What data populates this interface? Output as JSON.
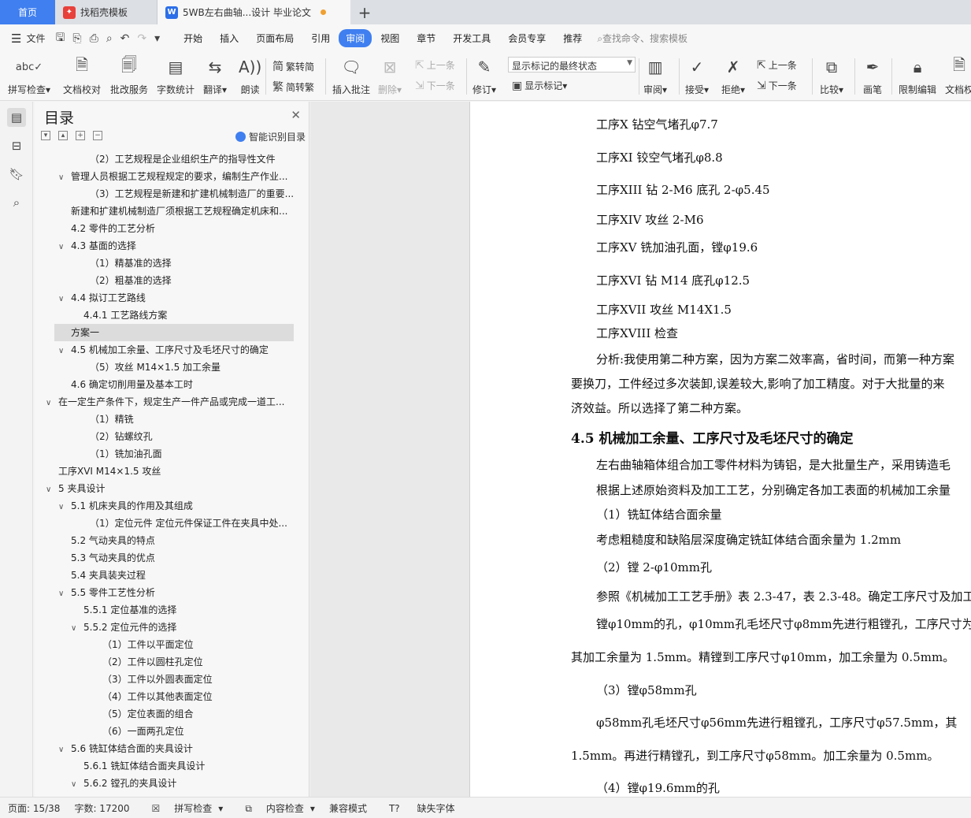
{
  "tabs": {
    "home": "首页",
    "template": "找稻壳模板",
    "doc": "5WB左右曲轴...设计 毕业论文"
  },
  "menu": {
    "file": "文件",
    "items": [
      "开始",
      "插入",
      "页面布局",
      "引用",
      "审阅",
      "视图",
      "章节",
      "开发工具",
      "会员专享",
      "推荐"
    ],
    "search": "查找命令、搜索模板"
  },
  "ribbon": {
    "spell": "拼写检查",
    "proof": "文档校对",
    "batch": "批改服务",
    "wordcount": "字数统计",
    "translate": "翻译",
    "read": "朗读",
    "trad": "繁转简",
    "simp": "简转繁",
    "insert_comment": "插入批注",
    "delete": "删除",
    "prev": "上一条",
    "next": "下一条",
    "revise": "修订",
    "display_combo": "显示标记的最终状态",
    "show_marks": "显示标记",
    "review": "审阅",
    "accept": "接受",
    "reject": "拒绝",
    "prev2": "上一条",
    "next2": "下一条",
    "compare": "比较",
    "pen": "画笔",
    "restrict": "限制编辑",
    "docpriv": "文档权"
  },
  "nav": {
    "title": "目录",
    "smart": "智能识别目录",
    "items": [
      {
        "text": "（2）工艺规程是企业组织生产的指导性文件",
        "level": 3,
        "chev": false
      },
      {
        "text": "管理人员根据工艺规程规定的要求，编制生产作业...",
        "level": 1,
        "chev": true
      },
      {
        "text": "（3）工艺规程是新建和扩建机械制造厂的重要...",
        "level": 3,
        "chev": false
      },
      {
        "text": "新建和扩建机械制造厂须根据工艺规程确定机床和...",
        "level": 1,
        "chev": false
      },
      {
        "text": "4.2   零件的工艺分析",
        "level": 1,
        "chev": false
      },
      {
        "text": "4.3   基面的选择",
        "level": 1,
        "chev": true
      },
      {
        "text": "（1）精基准的选择",
        "level": 3,
        "chev": false
      },
      {
        "text": "（2）粗基准的选择",
        "level": 3,
        "chev": false
      },
      {
        "text": "4.4   拟订工艺路线",
        "level": 1,
        "chev": true
      },
      {
        "text": "4.4.1   工艺路线方案",
        "level": 2,
        "chev": false
      },
      {
        "text": "方案一",
        "level": 1,
        "chev": false
      },
      {
        "text": "4.5   机械加工余量、工序尺寸及毛坯尺寸的确定",
        "level": 1,
        "chev": true
      },
      {
        "text": "（5）攻丝 M14×1.5 加工余量",
        "level": 3,
        "chev": false
      },
      {
        "text": "4.6   确定切削用量及基本工时",
        "level": 1,
        "chev": false
      },
      {
        "text": "在一定生产条件下，规定生产一件产品或完成一道工...",
        "level": 0,
        "chev": true
      },
      {
        "text": "（1）精铣",
        "level": 3,
        "chev": false
      },
      {
        "text": "（2）钻螺纹孔",
        "level": 3,
        "chev": false
      },
      {
        "text": "（1）铣加油孔面",
        "level": 3,
        "chev": false
      },
      {
        "text": "工序XVI    M14×1.5 攻丝",
        "level": 0,
        "chev": false
      },
      {
        "text": "5   夹具设计",
        "level": 0,
        "chev": true
      },
      {
        "text": "5.1   机床夹具的作用及其组成",
        "level": 1,
        "chev": true
      },
      {
        "text": "（1）定位元件    定位元件保证工件在夹具中处...",
        "level": 3,
        "chev": false
      },
      {
        "text": "5.2   气动夹具的特点",
        "level": 1,
        "chev": false
      },
      {
        "text": "5.3   气动夹具的优点",
        "level": 1,
        "chev": false
      },
      {
        "text": "5.4   夹具装夹过程",
        "level": 1,
        "chev": false
      },
      {
        "text": "5.5   零件工艺性分析",
        "level": 1,
        "chev": true
      },
      {
        "text": "5.5.1   定位基准的选择",
        "level": 2,
        "chev": false
      },
      {
        "text": "5.5.2   定位元件的选择",
        "level": 2,
        "chev": true
      },
      {
        "text": "（1）工件以平面定位",
        "level": 4,
        "chev": false
      },
      {
        "text": "（2）工件以圆柱孔定位",
        "level": 4,
        "chev": false
      },
      {
        "text": "（3）工件以外圆表面定位",
        "level": 4,
        "chev": false
      },
      {
        "text": "（4）工件以其他表面定位",
        "level": 4,
        "chev": false
      },
      {
        "text": "（5）定位表面的组合",
        "level": 4,
        "chev": false
      },
      {
        "text": "（6）一面两孔定位",
        "level": 4,
        "chev": false
      },
      {
        "text": "5.6   铣缸体结合面的夹具设计",
        "level": 1,
        "chev": true
      },
      {
        "text": "5.6.1   铣缸体结合面夹具设计",
        "level": 2,
        "chev": false
      },
      {
        "text": "5.6.2   镗孔的夹具设计",
        "level": 2,
        "chev": true
      }
    ]
  },
  "document": {
    "lines": [
      {
        "text": "工序X    钻空气堵孔φ7.7",
        "indent": true
      },
      {
        "text": "工序XI    铰空气堵孔φ8.8",
        "indent": true
      },
      {
        "text": "工序XIII    钻 2-M6 底孔 2-φ5.45",
        "indent": true
      },
      {
        "text": "工序XIV    攻丝 2-M6",
        "indent": true
      },
      {
        "text": "工序XV    铣加油孔面，镗φ19.6",
        "indent": true
      },
      {
        "text": "工序XVI    钻 M14 底孔φ12.5",
        "indent": true
      },
      {
        "text": "工序XVII    攻丝 M14X1.5",
        "indent": true
      },
      {
        "text": "工序XVIII    检查",
        "indent": true
      },
      {
        "text": "分析:我使用第二种方案，因为方案二效率高，省时间，而第一种方案",
        "indent": true
      },
      {
        "text": "要换刀，工件经过多次装卸,误差较大,影响了加工精度。对于大批量的来",
        "indent": false
      },
      {
        "text": "济效益。所以选择了第二种方案。",
        "indent": false
      },
      {
        "text": "4.5    机械加工余量、工序尺寸及毛坯尺寸的确定",
        "indent": false,
        "heading": true
      },
      {
        "text": "左右曲轴箱体组合加工零件材料为铸铝，是大批量生产，采用铸造毛",
        "indent": true
      },
      {
        "text": "根据上述原始资料及加工工艺，分别确定各加工表面的机械加工余量",
        "indent": true
      },
      {
        "text": "（1）铣缸体结合面余量",
        "indent": true
      },
      {
        "text": "考虑粗糙度和缺陷层深度确定铣缸体结合面余量为 1.2mm",
        "indent": true
      },
      {
        "text": "（2）镗 2-φ10mm孔",
        "indent": true
      },
      {
        "text": "参照《机械加工工艺手册》表 2.3-47，表 2.3-48。确定工序尺寸及加工",
        "indent": true
      },
      {
        "text": "镗φ10mm的孔，φ10mm孔毛坯尺寸φ8mm先进行粗镗孔，工序尺寸为",
        "indent": true
      },
      {
        "text": "其加工余量为 1.5mm。精镗到工序尺寸φ10mm，加工余量为 0.5mm。",
        "indent": false
      },
      {
        "text": "（3）镗φ58mm孔",
        "indent": true
      },
      {
        "text": "φ58mm孔毛坯尺寸φ56mm先进行粗镗孔，工序尺寸φ57.5mm，其",
        "indent": true
      },
      {
        "text": "1.5mm。再进行精镗孔，到工序尺寸φ58mm。加工余量为 0.5mm。",
        "indent": false
      },
      {
        "text": "（4）镗φ19.6mm的孔",
        "indent": true
      }
    ]
  },
  "status": {
    "page": "页面: 15/38",
    "words": "字数: 17200",
    "spell": "拼写检查",
    "content": "内容检查",
    "compat": "兼容模式",
    "font": "缺失字体"
  }
}
